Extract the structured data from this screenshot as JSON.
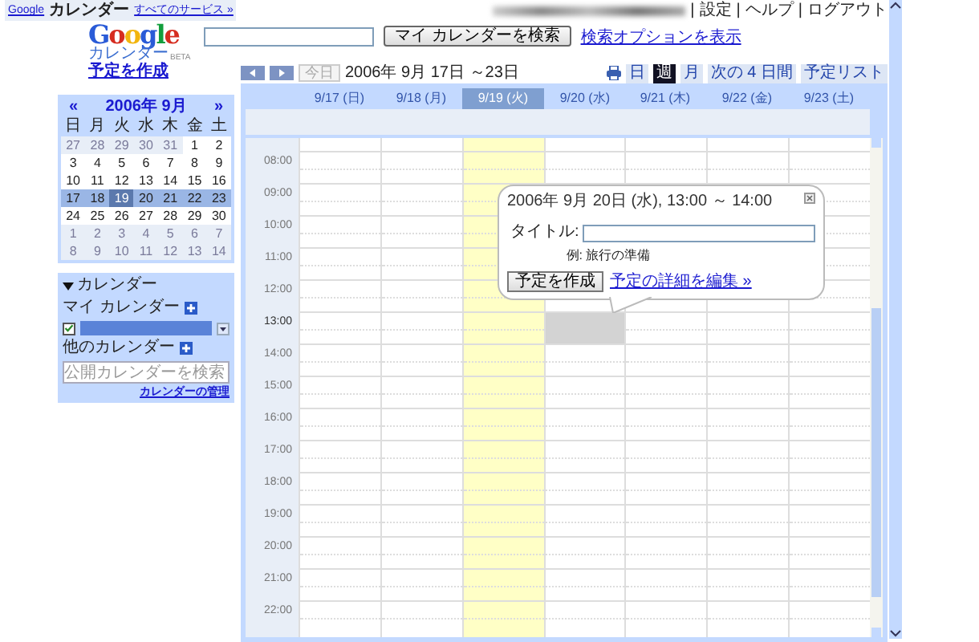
{
  "top_bar": {
    "brand": "Google",
    "product": "カレンダー",
    "services_link": "すべてのサービス »",
    "links": [
      "設定",
      "ヘルプ",
      "ログアウト"
    ],
    "separator": "|"
  },
  "logo": {
    "wordmark": "Google",
    "subtitle": "カレンダー",
    "badge": "BETA"
  },
  "search": {
    "button": "マイ カレンダーを検索",
    "options_link": "検索オプションを表示"
  },
  "create_link": "予定を作成",
  "toolbar": {
    "today": "今日",
    "today_disabled": true,
    "range": "2006年 9月 17日 ～23日",
    "views": [
      {
        "label": "日",
        "selected": false
      },
      {
        "label": "週",
        "selected": true
      },
      {
        "label": "月",
        "selected": false
      },
      {
        "label": "次の 4 日間",
        "selected": false
      },
      {
        "label": "予定リスト",
        "selected": false
      }
    ]
  },
  "mini_calendar": {
    "prev": "«",
    "title": "2006年 9月",
    "next": "»",
    "weekdays": [
      "日",
      "月",
      "火",
      "水",
      "木",
      "金",
      "土"
    ],
    "weeks": [
      {
        "in_range": false,
        "days": [
          {
            "day": "27",
            "in_month": false,
            "selected": false
          },
          {
            "day": "28",
            "in_month": false,
            "selected": false
          },
          {
            "day": "29",
            "in_month": false,
            "selected": false
          },
          {
            "day": "30",
            "in_month": false,
            "selected": false
          },
          {
            "day": "31",
            "in_month": false,
            "selected": false
          },
          {
            "day": "1",
            "in_month": true,
            "selected": false
          },
          {
            "day": "2",
            "in_month": true,
            "selected": false
          }
        ]
      },
      {
        "in_range": false,
        "days": [
          {
            "day": "3",
            "in_month": true,
            "selected": false
          },
          {
            "day": "4",
            "in_month": true,
            "selected": false
          },
          {
            "day": "5",
            "in_month": true,
            "selected": false
          },
          {
            "day": "6",
            "in_month": true,
            "selected": false
          },
          {
            "day": "7",
            "in_month": true,
            "selected": false
          },
          {
            "day": "8",
            "in_month": true,
            "selected": false
          },
          {
            "day": "9",
            "in_month": true,
            "selected": false
          }
        ]
      },
      {
        "in_range": false,
        "days": [
          {
            "day": "10",
            "in_month": true,
            "selected": false
          },
          {
            "day": "11",
            "in_month": true,
            "selected": false
          },
          {
            "day": "12",
            "in_month": true,
            "selected": false
          },
          {
            "day": "13",
            "in_month": true,
            "selected": false
          },
          {
            "day": "14",
            "in_month": true,
            "selected": false
          },
          {
            "day": "15",
            "in_month": true,
            "selected": false
          },
          {
            "day": "16",
            "in_month": true,
            "selected": false
          }
        ]
      },
      {
        "in_range": true,
        "days": [
          {
            "day": "17",
            "in_month": true,
            "selected": false
          },
          {
            "day": "18",
            "in_month": true,
            "selected": false
          },
          {
            "day": "19",
            "in_month": true,
            "selected": true
          },
          {
            "day": "20",
            "in_month": true,
            "selected": false
          },
          {
            "day": "21",
            "in_month": true,
            "selected": false
          },
          {
            "day": "22",
            "in_month": true,
            "selected": false
          },
          {
            "day": "23",
            "in_month": true,
            "selected": false
          }
        ]
      },
      {
        "in_range": false,
        "days": [
          {
            "day": "24",
            "in_month": true,
            "selected": false
          },
          {
            "day": "25",
            "in_month": true,
            "selected": false
          },
          {
            "day": "26",
            "in_month": true,
            "selected": false
          },
          {
            "day": "27",
            "in_month": true,
            "selected": false
          },
          {
            "day": "28",
            "in_month": true,
            "selected": false
          },
          {
            "day": "29",
            "in_month": true,
            "selected": false
          },
          {
            "day": "30",
            "in_month": true,
            "selected": false
          }
        ]
      },
      {
        "in_range": false,
        "days": [
          {
            "day": "1",
            "in_month": false,
            "selected": false
          },
          {
            "day": "2",
            "in_month": false,
            "selected": false
          },
          {
            "day": "3",
            "in_month": false,
            "selected": false
          },
          {
            "day": "4",
            "in_month": false,
            "selected": false
          },
          {
            "day": "5",
            "in_month": false,
            "selected": false
          },
          {
            "day": "6",
            "in_month": false,
            "selected": false
          },
          {
            "day": "7",
            "in_month": false,
            "selected": false
          }
        ]
      },
      {
        "in_range": false,
        "days": [
          {
            "day": "8",
            "in_month": false,
            "selected": false
          },
          {
            "day": "9",
            "in_month": false,
            "selected": false
          },
          {
            "day": "10",
            "in_month": false,
            "selected": false
          },
          {
            "day": "11",
            "in_month": false,
            "selected": false
          },
          {
            "day": "12",
            "in_month": false,
            "selected": false
          },
          {
            "day": "13",
            "in_month": false,
            "selected": false
          },
          {
            "day": "14",
            "in_month": false,
            "selected": false
          }
        ]
      }
    ]
  },
  "calendars": {
    "heading": "カレンダー",
    "expanded": true,
    "my_label": "マイ カレンダー",
    "items": [
      {
        "checked": true,
        "color": "#5a83d8"
      }
    ],
    "other_label": "他のカレンダー",
    "search_placeholder": "公開カレンダーを検索",
    "manage_link": "カレンダーの管理"
  },
  "week_grid": {
    "days": [
      {
        "label": "9/17 (日)",
        "today": false,
        "selected": false
      },
      {
        "label": "9/18 (月)",
        "today": false,
        "selected": false
      },
      {
        "label": "9/19 (火)",
        "today": true,
        "selected": false
      },
      {
        "label": "9/20 (水)",
        "today": false,
        "selected": true
      },
      {
        "label": "9/21 (木)",
        "today": false,
        "selected": false
      },
      {
        "label": "9/22 (金)",
        "today": false,
        "selected": false
      },
      {
        "label": "9/23 (土)",
        "today": false,
        "selected": false
      }
    ],
    "hours": [
      {
        "label": "08:00",
        "selected": false
      },
      {
        "label": "09:00",
        "selected": false
      },
      {
        "label": "10:00",
        "selected": false
      },
      {
        "label": "11:00",
        "selected": false
      },
      {
        "label": "12:00",
        "selected": false
      },
      {
        "label": "13:00",
        "selected": true
      },
      {
        "label": "14:00",
        "selected": false
      },
      {
        "label": "15:00",
        "selected": false
      },
      {
        "label": "16:00",
        "selected": false
      },
      {
        "label": "17:00",
        "selected": false
      },
      {
        "label": "18:00",
        "selected": false
      },
      {
        "label": "19:00",
        "selected": false
      },
      {
        "label": "20:00",
        "selected": false
      },
      {
        "label": "21:00",
        "selected": false
      },
      {
        "label": "22:00",
        "selected": false
      }
    ]
  },
  "popup": {
    "when": "2006年 9月 20日 (水), 13:00 ～ 14:00",
    "title_label": "タイトル:",
    "example": "例: 旅行の準備",
    "create_button": "予定を作成",
    "details_link": "予定の詳細を編集 »"
  }
}
